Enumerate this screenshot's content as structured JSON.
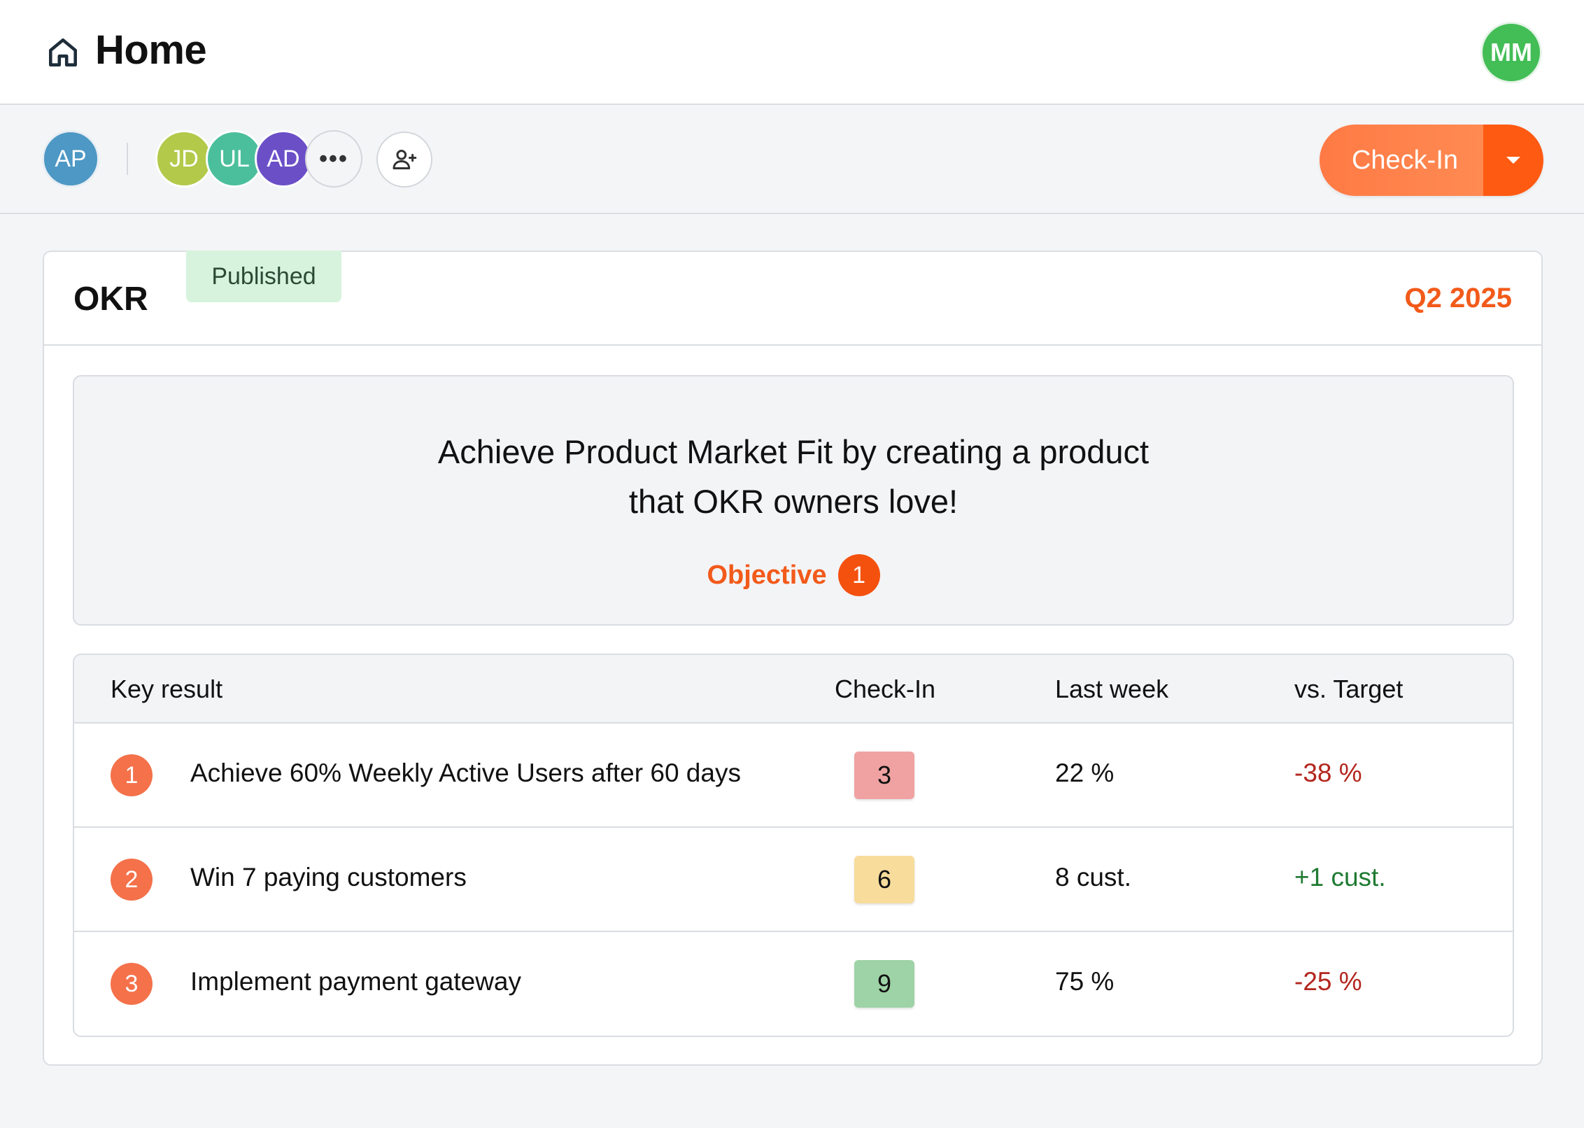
{
  "header": {
    "title": "Home",
    "user_initials": "MM"
  },
  "toolbar": {
    "owner_initials": "AP",
    "members": [
      "JD",
      "UL",
      "AD"
    ],
    "more_label": "•••",
    "checkin_label": "Check-In"
  },
  "okr": {
    "label": "OKR",
    "status": "Published",
    "quarter": "Q2 2025",
    "objective": {
      "text": "Achieve Product Market Fit by creating a product that OKR owners love!",
      "label": "Objective",
      "number": "1"
    },
    "table": {
      "columns": [
        "Key result",
        "Check-In",
        "Last week",
        "vs. Target"
      ],
      "rows": [
        {
          "num": "1",
          "title": "Achieve 60% Weekly Active Users after 60 days",
          "score": "3",
          "last_week": "22 %",
          "vs_target": "-38 %"
        },
        {
          "num": "2",
          "title": "Win 7 paying customers",
          "score": "6",
          "last_week": "8 cust.",
          "vs_target": "+1 cust."
        },
        {
          "num": "3",
          "title": "Implement payment gateway",
          "score": "9",
          "last_week": "75 %",
          "vs_target": "-25 %"
        }
      ]
    }
  },
  "colors": {
    "accent": "#f25a1a",
    "score_low": "#f0a2a2",
    "score_mid": "#f7dc9c",
    "score_high": "#9dd3a6",
    "negative": "#b3261e",
    "positive": "#1f7a32",
    "published_bg": "#d7f3dd"
  },
  "icons": {
    "home": "home-icon",
    "add_member": "user-plus-icon",
    "dropdown": "caret-down-icon"
  }
}
